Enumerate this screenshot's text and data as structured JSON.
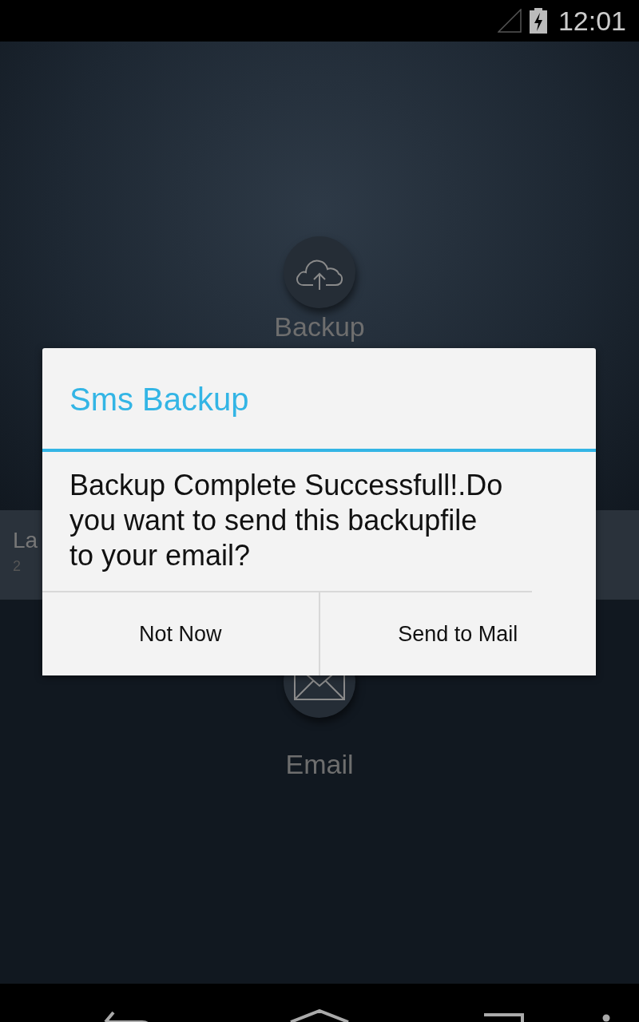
{
  "status_bar": {
    "time": "12:01"
  },
  "screen": {
    "backup_label": "Backup",
    "last_backup": {
      "title": "La",
      "date": "2"
    },
    "email_label": "Email"
  },
  "dialog": {
    "title": "Sms Backup",
    "message": "Backup Complete Successfull!.Do you want to send this backupfile to your email?",
    "buttons": [
      "Not Now",
      "Send to Mail"
    ]
  }
}
